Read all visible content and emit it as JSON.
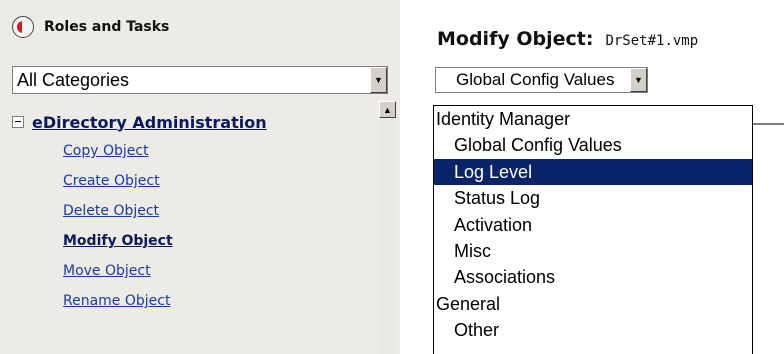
{
  "left_panel": {
    "title": "Roles and Tasks",
    "category_select": {
      "value": "All Categories"
    },
    "section": {
      "title": "eDirectory Administration",
      "tasks": [
        {
          "label": "Copy Object"
        },
        {
          "label": "Create Object"
        },
        {
          "label": "Delete Object"
        },
        {
          "label": "Modify Object",
          "active": true
        },
        {
          "label": "Move Object"
        },
        {
          "label": "Rename Object"
        }
      ]
    }
  },
  "main": {
    "title": "Modify Object:",
    "object_name": "DrSet#1.vmp",
    "config_select": {
      "value": "Global Config Values"
    },
    "dropdown_options": [
      {
        "label": "Identity Manager",
        "group": true
      },
      {
        "label": "Global Config Values"
      },
      {
        "label": "Log Level",
        "selected": true
      },
      {
        "label": "Status Log"
      },
      {
        "label": "Activation"
      },
      {
        "label": "Misc"
      },
      {
        "label": "Associations"
      },
      {
        "label": "General",
        "group": true
      },
      {
        "label": "Other"
      }
    ]
  },
  "icons": {
    "roles": "roles-tasks-icon",
    "dropdown": "chevron-down-icon",
    "collapse": "collapse-minus-icon",
    "scroll_up": "scroll-up-arrow-icon"
  },
  "colors": {
    "panel_bg": "#ecebe6",
    "link": "#1a3aa6",
    "selection": "#0a246a"
  }
}
